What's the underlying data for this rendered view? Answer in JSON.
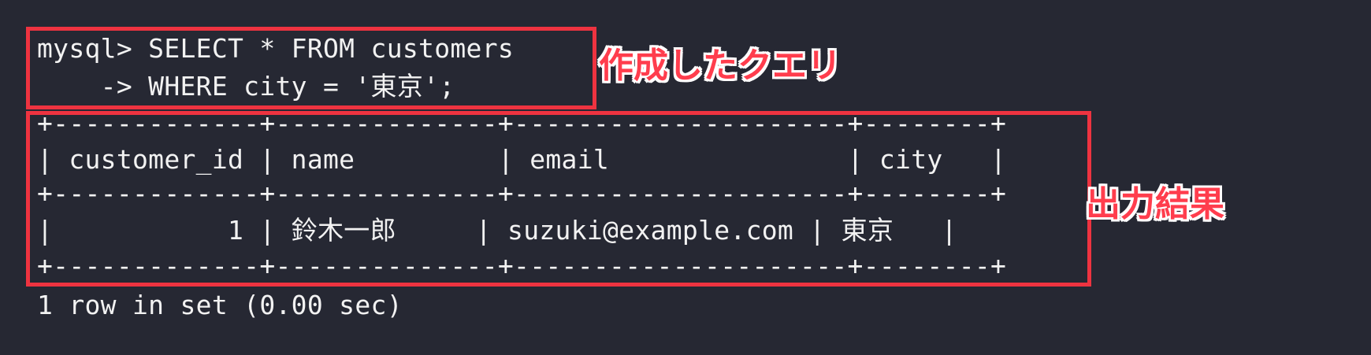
{
  "terminal": {
    "query": {
      "line1": "mysql> SELECT * FROM customers",
      "line2": "    -> WHERE city = '東京';"
    },
    "result": {
      "border_top": "+-------------+--------------+---------------------+--------+",
      "header_row": "| customer_id | name         | email               | city   |",
      "border_mid": "+-------------+--------------+---------------------+--------+",
      "data_row": "|           1 | 鈴木一郎     | suzuki@example.com | 東京   |",
      "border_bottom": "+-------------+--------------+---------------------+--------+"
    },
    "status": "1 row in set (0.00 sec)"
  },
  "annotations": {
    "query_label": "作成したクエリ",
    "result_label": "出力結果"
  },
  "colors": {
    "background": "#262833",
    "text": "#f2f2f2",
    "highlight": "#ee3340"
  }
}
